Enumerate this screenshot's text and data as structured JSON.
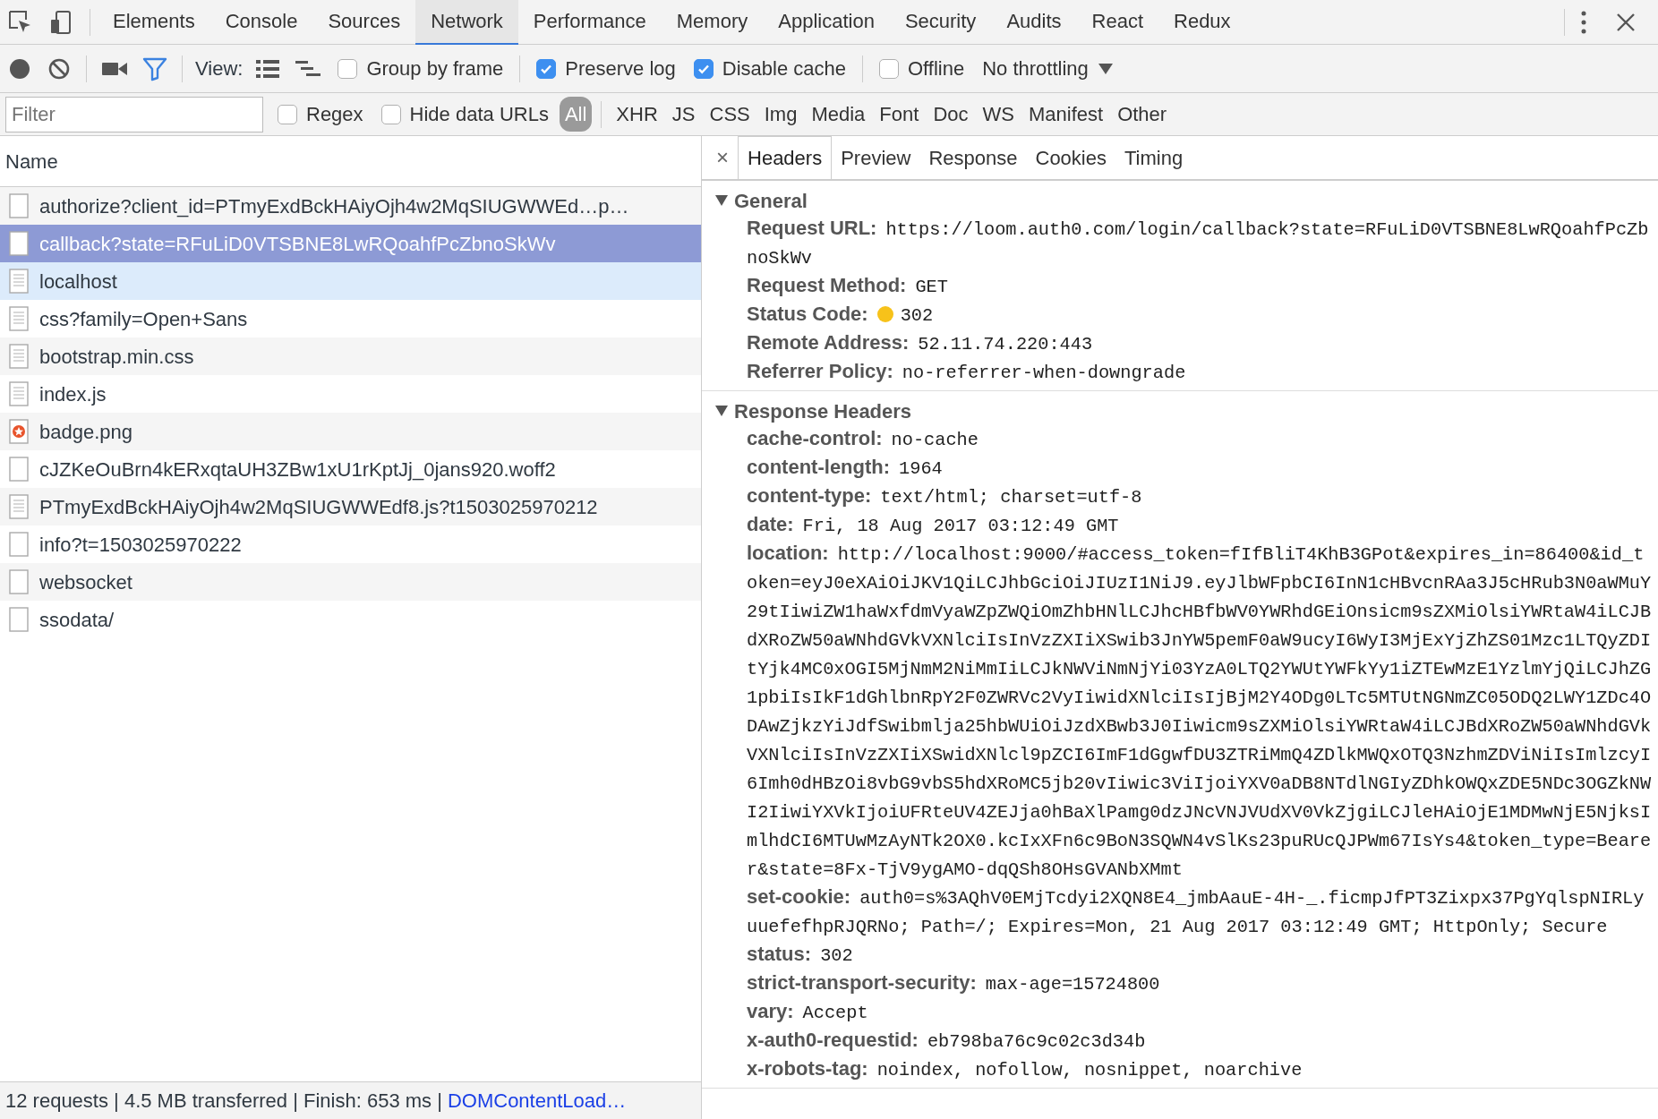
{
  "main_tabs": [
    {
      "label": "Elements",
      "selected": false
    },
    {
      "label": "Console",
      "selected": false
    },
    {
      "label": "Sources",
      "selected": false
    },
    {
      "label": "Network",
      "selected": true
    },
    {
      "label": "Performance",
      "selected": false
    },
    {
      "label": "Memory",
      "selected": false
    },
    {
      "label": "Application",
      "selected": false
    },
    {
      "label": "Security",
      "selected": false
    },
    {
      "label": "Audits",
      "selected": false
    },
    {
      "label": "React",
      "selected": false
    },
    {
      "label": "Redux",
      "selected": false
    }
  ],
  "view_label": "View:",
  "options": [
    {
      "label": "Group by frame",
      "checked": false
    },
    {
      "label": "Preserve log",
      "checked": true
    },
    {
      "label": "Disable cache",
      "checked": true
    },
    {
      "label": "Offline",
      "checked": false
    }
  ],
  "throttling": "No throttling",
  "filter": {
    "placeholder": "Filter"
  },
  "filter_options": [
    {
      "label": "Regex",
      "checked": false
    },
    {
      "label": "Hide data URLs",
      "checked": false
    }
  ],
  "type_filters": [
    {
      "label": "All",
      "selected": true
    },
    {
      "label": "XHR",
      "selected": false
    },
    {
      "label": "JS",
      "selected": false
    },
    {
      "label": "CSS",
      "selected": false
    },
    {
      "label": "Img",
      "selected": false
    },
    {
      "label": "Media",
      "selected": false
    },
    {
      "label": "Font",
      "selected": false
    },
    {
      "label": "Doc",
      "selected": false
    },
    {
      "label": "WS",
      "selected": false
    },
    {
      "label": "Manifest",
      "selected": false
    },
    {
      "label": "Other",
      "selected": false
    }
  ],
  "requests": {
    "column": "Name",
    "rows": [
      {
        "name": "authorize?client_id=PTmyExdBckHAiyOjh4w2MqSIUGWWEd…p…",
        "kind": "blank",
        "selected": false,
        "hovered": false
      },
      {
        "name": "callback?state=RFuLiD0VTSBNE8LwRQoahfPcZbnoSkWv",
        "kind": "blank",
        "selected": true,
        "hovered": false
      },
      {
        "name": "localhost",
        "kind": "document",
        "selected": false,
        "hovered": true
      },
      {
        "name": "css?family=Open+Sans",
        "kind": "document",
        "selected": false,
        "hovered": false
      },
      {
        "name": "bootstrap.min.css",
        "kind": "document",
        "selected": false,
        "hovered": false
      },
      {
        "name": "index.js",
        "kind": "document",
        "selected": false,
        "hovered": false
      },
      {
        "name": "badge.png",
        "kind": "image",
        "selected": false,
        "hovered": false
      },
      {
        "name": "cJZKeOuBrn4kERxqtaUH3ZBw1xU1rKptJj_0jans920.woff2",
        "kind": "blank",
        "selected": false,
        "hovered": false
      },
      {
        "name": "PTmyExdBckHAiyOjh4w2MqSIUGWWEdf8.js?t1503025970212",
        "kind": "document",
        "selected": false,
        "hovered": false
      },
      {
        "name": "info?t=1503025970222",
        "kind": "blank",
        "selected": false,
        "hovered": false
      },
      {
        "name": "websocket",
        "kind": "blank",
        "selected": false,
        "hovered": false
      },
      {
        "name": "ssodata/",
        "kind": "blank",
        "selected": false,
        "hovered": false
      }
    ]
  },
  "status_bar": {
    "summary": "12 requests | 4.5 MB transferred | Finish: 653 ms |",
    "link": "DOMContentLoad…"
  },
  "detail_close": "×",
  "detail_tabs": [
    {
      "label": "Headers",
      "selected": true
    },
    {
      "label": "Preview",
      "selected": false
    },
    {
      "label": "Response",
      "selected": false
    },
    {
      "label": "Cookies",
      "selected": false
    },
    {
      "label": "Timing",
      "selected": false
    }
  ],
  "sections": [
    {
      "title": "General",
      "expanded": true,
      "headers": [
        {
          "name": "Request URL:",
          "value": "https://loom.auth0.com/login/callback?state=RFuLiD0VTSBNE8LwRQoahfPcZbnoSkWv"
        },
        {
          "name": "Request Method:",
          "value": "GET"
        },
        {
          "name": "Status Code:",
          "value": "302",
          "color": "#f7c21a"
        },
        {
          "name": "Remote Address:",
          "value": "52.11.74.220:443"
        },
        {
          "name": "Referrer Policy:",
          "value": "no-referrer-when-downgrade"
        }
      ]
    },
    {
      "title": "Response Headers",
      "expanded": true,
      "headers": [
        {
          "name": "cache-control:",
          "value": "no-cache"
        },
        {
          "name": "content-length:",
          "value": "1964"
        },
        {
          "name": "content-type:",
          "value": "text/html; charset=utf-8"
        },
        {
          "name": "date:",
          "value": "Fri, 18 Aug 2017 03:12:49 GMT"
        },
        {
          "name": "location:",
          "value": "http://localhost:9000/#access_token=fIfBliT4KhB3GPot&expires_in=86400&id_token=eyJ0eXAiOiJKV1QiLCJhbGciOiJIUzI1NiJ9.eyJlbWFpbCI6InN1cHBvcnRAa3J5cHRub3N0aWMuY29tIiwiZW1haWxfdmVyaWZpZWQiOmZhbHNlLCJhcHBfbWV0YWRhdGEiOnsicm9sZXMiOlsiYWRtaW4iLCJBdXRoZW50aWNhdGVkVXNlciIsInVzZXIiXSwib3JnYW5pemF0aW9ucyI6WyI3MjExYjZhZS01Mzc1LTQyZDItYjk4MC0xOGI5MjNmM2NiMmIiLCJkNWViNmNjYi03YzA0LTQ2YWUtYWFkYy1iZTEwMzE1YzlmYjQiLCJhZG1pbiIsIkF1dGhlbnRpY2F0ZWRVc2VyIiwidXNlciIsIjBjM2Y4ODg0LTc5MTUtNGNmZC05ODQ2LWY1ZDc4ODAwZjkzYiJdfSwibmlja25hbWUiOiJzdXBwb3J0Iiwicm9sZXMiOlsiYWRtaW4iLCJBdXRoZW50aWNhdGVkVXNlciIsInVzZXIiXSwidXNlcl9pZCI6ImF1dGgwfDU3ZTRiMmQ4ZDlkMWQxOTQ3NzhmZDViNiIsImlzcyI6Imh0dHBzOi8vbG9vbS5hdXRoMC5jb20vIiwic3ViIjoiYXV0aDB8NTdlNGIyZDhkOWQxZDE5NDc3OGZkNWI2IiwiYXVkIjoiUFRteUV4ZEJja0hBaXlPamg0dzJNcVNJVUdXV0VkZjgiLCJleHAiOjE1MDMwNjE5NjksImlhdCI6MTUwMzAyNTk2OX0.kcIxXFn6c9BoN3SQWN4vSlKs23puRUcQJPWm67IsYs4&token_type=Bearer&state=8Fx-TjV9ygAMO-dqQSh8OHsGVANbXMmt"
        },
        {
          "name": "set-cookie:",
          "value": "auth0=s%3AQhV0EMjTcdyi2XQN8E4_jmbAauE-4H-_.ficmpJfPT3Zixpx37PgYqlspNIRLyuuefefhpRJQRNo; Path=/; Expires=Mon, 21 Aug 2017 03:12:49 GMT; HttpOnly; Secure"
        },
        {
          "name": "status:",
          "value": "302"
        },
        {
          "name": "strict-transport-security:",
          "value": "max-age=15724800"
        },
        {
          "name": "vary:",
          "value": "Accept"
        },
        {
          "name": "x-auth0-requestid:",
          "value": "eb798ba76c9c02c3d34b"
        },
        {
          "name": "x-robots-tag:",
          "value": "noindex, nofollow, nosnippet, noarchive"
        }
      ]
    }
  ]
}
